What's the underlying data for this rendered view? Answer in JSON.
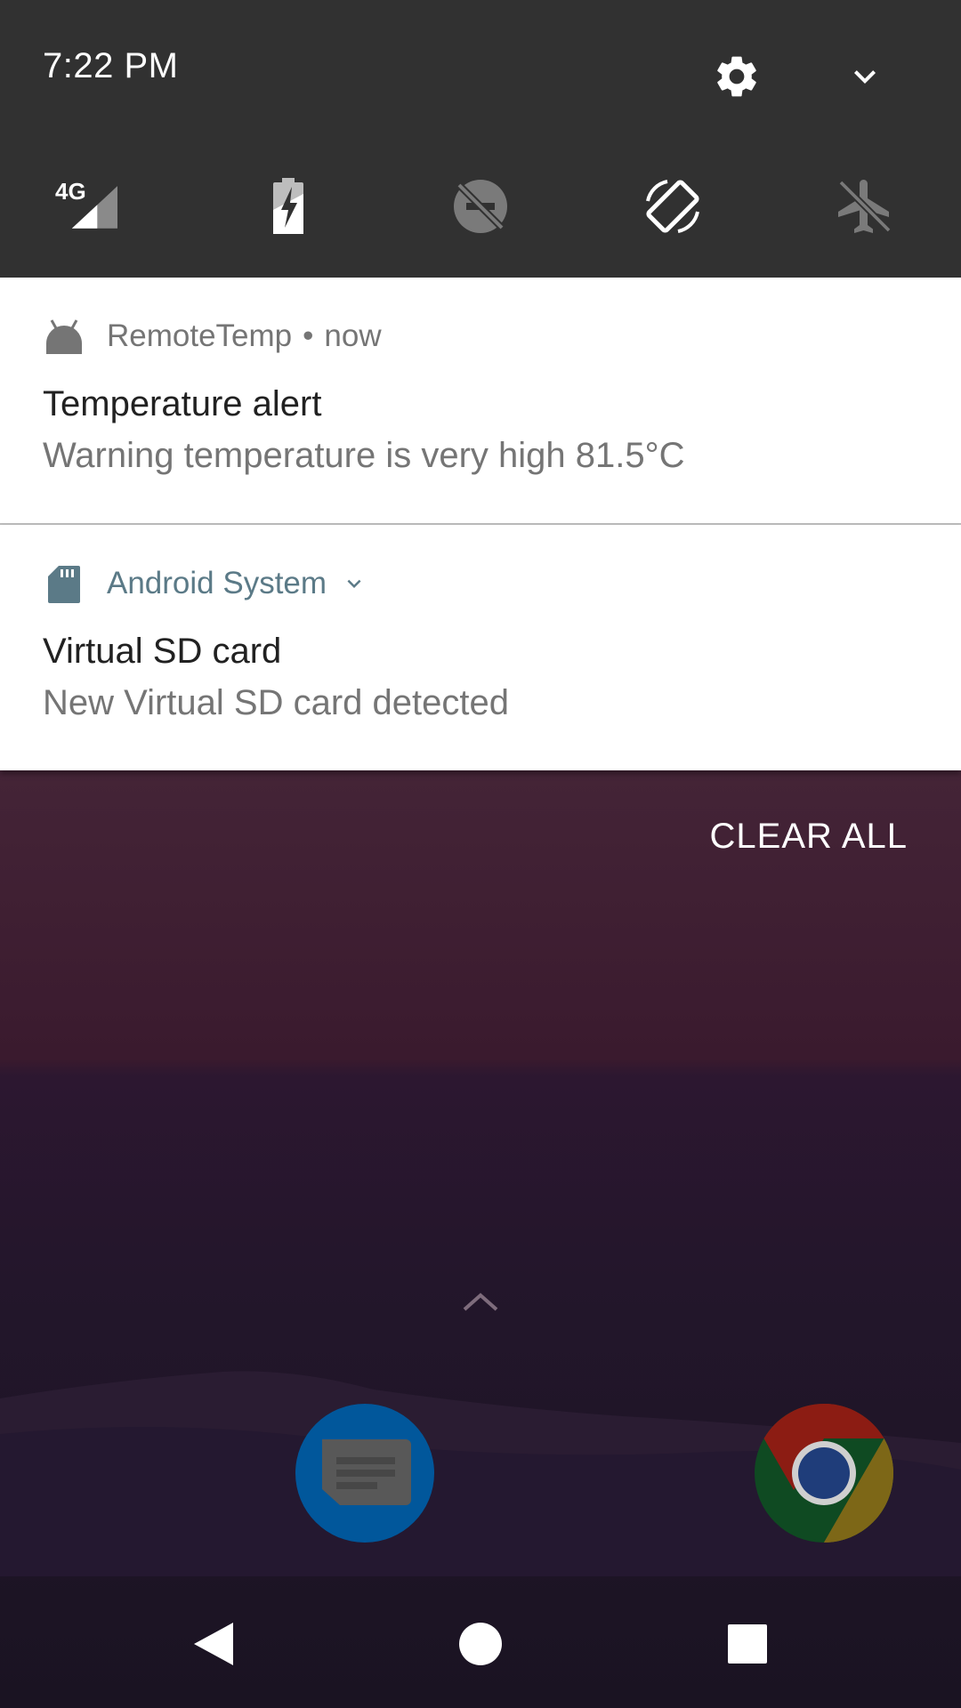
{
  "status": {
    "time": "7:22 PM",
    "network_label": "4G"
  },
  "quick_settings": {
    "tiles": [
      {
        "icon": "signal-4g-icon"
      },
      {
        "icon": "battery-charging-icon"
      },
      {
        "icon": "dnd-off-icon"
      },
      {
        "icon": "auto-rotate-icon"
      },
      {
        "icon": "airplane-mode-icon"
      }
    ]
  },
  "notifications": [
    {
      "app": "RemoteTemp",
      "separator": "•",
      "time": "now",
      "title": "Temperature alert",
      "text": "Warning temperature is very high 81.5°C"
    },
    {
      "app": "Android System",
      "title": "Virtual SD card",
      "text": "New Virtual SD card detected"
    }
  ],
  "clear_all_label": "CLEAR ALL",
  "dock": [
    {
      "icon": "messages-app-icon"
    },
    {
      "icon": "chrome-app-icon"
    }
  ],
  "colors": {
    "qs_background": "#313131",
    "notification_background": "#ffffff",
    "android_system_accent": "#5b7a87"
  }
}
